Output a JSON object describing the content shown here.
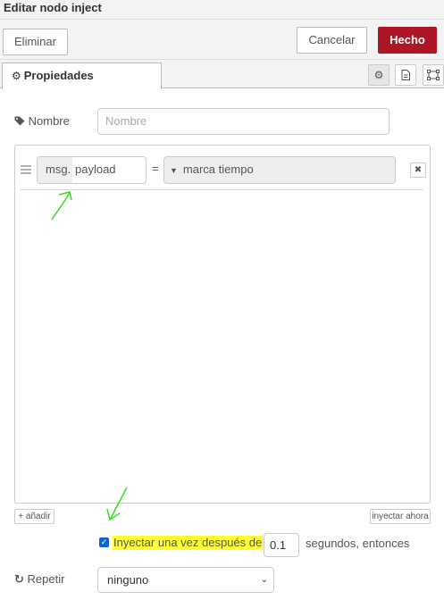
{
  "header": {
    "title": "Editar nodo inject"
  },
  "toolbar": {
    "delete_label": "Eliminar",
    "cancel_label": "Cancelar",
    "done_label": "Hecho",
    "done_color": "#ad1625"
  },
  "tabs": {
    "active": "Propiedades",
    "icons": [
      "gear-icon",
      "document-icon",
      "frame-icon"
    ]
  },
  "form": {
    "name_label": "Nombre",
    "name_placeholder": "Nombre",
    "property": {
      "prefix": "msg.",
      "value": "payload",
      "equals": "=",
      "type": "marca tiempo"
    },
    "add_label": "añadir",
    "inject_now_label": "inyectar ahora",
    "once_label": "Inyectar una vez después de",
    "once_delay": "0.1",
    "once_suffix": "segundos, entonces",
    "repeat_label": "Repetir",
    "repeat_value": "ninguno"
  },
  "annotations": {
    "arrow_color": "#33dd22",
    "highlight_color": "#ffff33"
  }
}
